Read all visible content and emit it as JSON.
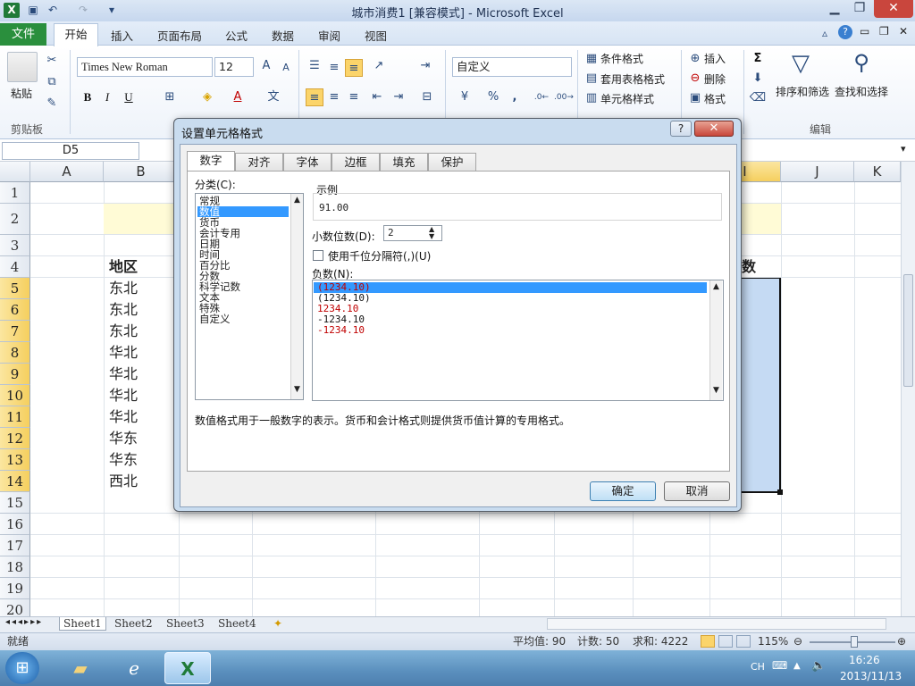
{
  "window": {
    "title": "城市消费1  [兼容模式] - Microsoft Excel"
  },
  "ribbon": {
    "tabs": [
      "文件",
      "开始",
      "插入",
      "页面布局",
      "公式",
      "数据",
      "审阅",
      "视图"
    ],
    "clipboard": {
      "paste": "粘贴",
      "group": "剪贴板"
    },
    "font": {
      "name": "Times New Roman",
      "size": "12",
      "bold": "B",
      "italic": "I",
      "underline": "U"
    },
    "number": {
      "format": "自定义",
      "percent": "%",
      "comma": ","
    },
    "styles": {
      "conditional": "条件格式",
      "table": "套用表格格式",
      "cell": "单元格样式"
    },
    "cells": {
      "insert": "插入",
      "delete": "删除",
      "format": "格式"
    },
    "editing": {
      "sort": "排序和筛选",
      "find": "查找和选择",
      "group": "编辑",
      "sum": "Σ"
    }
  },
  "namebox": "D5",
  "sheet": {
    "columns": [
      "A",
      "B",
      "I",
      "J",
      "K"
    ],
    "rows": [
      "1",
      "2",
      "3",
      "4",
      "5",
      "6",
      "7",
      "8",
      "9",
      "10",
      "11",
      "12",
      "13",
      "14",
      "15",
      "16",
      "17",
      "18",
      "19",
      "20"
    ],
    "header_cell": "地区",
    "header_cell_right": "数",
    "region_values": [
      "东北",
      "东北",
      "东北",
      "华北",
      "华北",
      "华北",
      "华北",
      "华东",
      "华东",
      "西北"
    ],
    "tabs": [
      "Sheet1",
      "Sheet2",
      "Sheet3",
      "Sheet4"
    ]
  },
  "dialog": {
    "title": "设置单元格格式",
    "help": "?",
    "close": "✕",
    "tabs": [
      "数字",
      "对齐",
      "字体",
      "边框",
      "填充",
      "保护"
    ],
    "category_label": "分类(C):",
    "categories": [
      "常规",
      "数值",
      "货币",
      "会计专用",
      "日期",
      "时间",
      "百分比",
      "分数",
      "科学记数",
      "文本",
      "特殊",
      "自定义"
    ],
    "selected_category": "数值",
    "sample_label": "示例",
    "sample_value": "91.00",
    "decimal_label": "小数位数(D):",
    "decimal_value": "2",
    "thousand_label": "使用千位分隔符(,)(U)",
    "negative_label": "负数(N):",
    "negative_options": [
      "(1234.10)",
      "(1234.10)",
      "1234.10",
      "-1234.10",
      "-1234.10"
    ],
    "negative_colors": [
      "#c00000",
      "#111111",
      "#c00000",
      "#111111",
      "#c00000"
    ],
    "description": "数值格式用于一般数字的表示。货币和会计格式则提供货币值计算的专用格式。",
    "ok": "确定",
    "cancel": "取消"
  },
  "statusbar": {
    "ready": "就绪",
    "average": "平均值: 90",
    "count": "计数: 50",
    "sum": "求和: 4222",
    "zoom": "115%"
  },
  "taskbar": {
    "lang": "CH",
    "time": "16:26",
    "date": "2013/11/13"
  }
}
